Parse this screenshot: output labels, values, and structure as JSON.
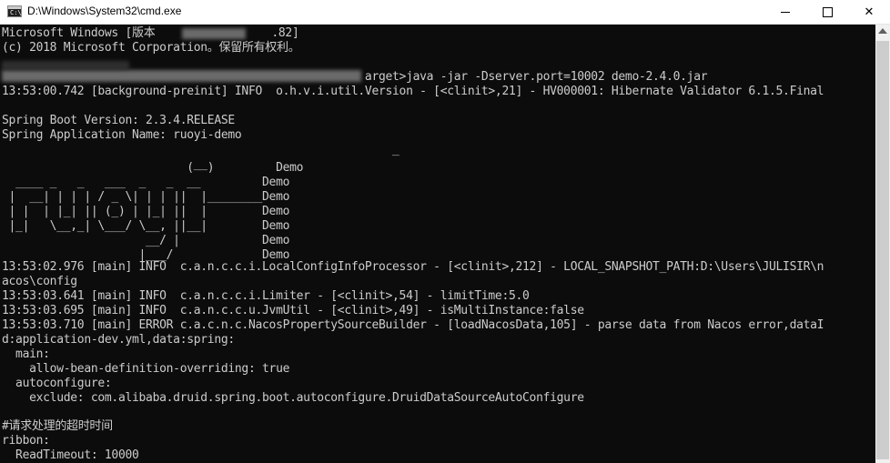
{
  "window": {
    "title": "D:\\Windows\\System32\\cmd.exe",
    "icon": "cmd-icon",
    "controls": {
      "minimize": "minimize-icon",
      "maximize": "maximize-icon",
      "close": "✕"
    }
  },
  "console": {
    "lines": [
      "Microsoft Windows [版本                 .82]",
      "(c) 2018 Microsoft Corporation。保留所有权利。",
      "",
      "                                                     arget>java -jar -Dserver.port=10002 demo-2.4.0.jar",
      "13:53:00.742 [background-preinit] INFO  o.h.v.i.util.Version - [<clinit>,21] - HV000001: Hibernate Validator 6.1.5.Final",
      "",
      "Spring Boot Version: 2.3.4.RELEASE",
      "Spring Application Name: ruoyi-demo"
    ],
    "ascii_art": [
      "                                                         _",
      "                            __                                 ",
      "                           (  )         Demo",
      "  ____ _   _   ___  _   _  __         Demo",
      " |  __| | | | / _ \\| | | ||  |________Demo",
      " | |  | |_| || (_) | |_| ||  |        Demo",
      " |_|   \\__,_| \\___/ \\__, ||__|        Demo",
      "                     __/ |            Demo",
      "                    |___/             Demo"
    ],
    "log_lines": [
      "13:53:02.976 [main] INFO  c.a.n.c.c.i.LocalConfigInfoProcessor - [<clinit>,212] - LOCAL_SNAPSHOT_PATH:D:\\Users\\JULISIR\\n",
      "acos\\config",
      "13:53:03.641 [main] INFO  c.a.n.c.c.i.Limiter - [<clinit>,54] - limitTime:5.0",
      "13:53:03.695 [main] INFO  c.a.n.c.c.u.JvmUtil - [<clinit>,49] - isMultiInstance:false",
      "13:53:03.710 [main] ERROR c.a.c.n.c.NacosPropertySourceBuilder - [loadNacosData,105] - parse data from Nacos error,dataI",
      "d:application-dev.yml,data:spring:",
      "  main:",
      "    allow-bean-definition-overriding: true",
      "  autoconfigure:",
      "    exclude: com.alibaba.druid.spring.boot.autoconfigure.DruidDataSourceAutoConfigure",
      "",
      "#请求处理的超时时间",
      "ribbon:",
      "  ReadTimeout: 10000"
    ]
  },
  "colors": {
    "console_bg": "#0c0c0c",
    "console_fg": "#cccccc",
    "titlebar_bg": "#ffffff",
    "scrollbar_bg": "#f0f0f0",
    "scrollbar_thumb": "#cdcdcd"
  }
}
